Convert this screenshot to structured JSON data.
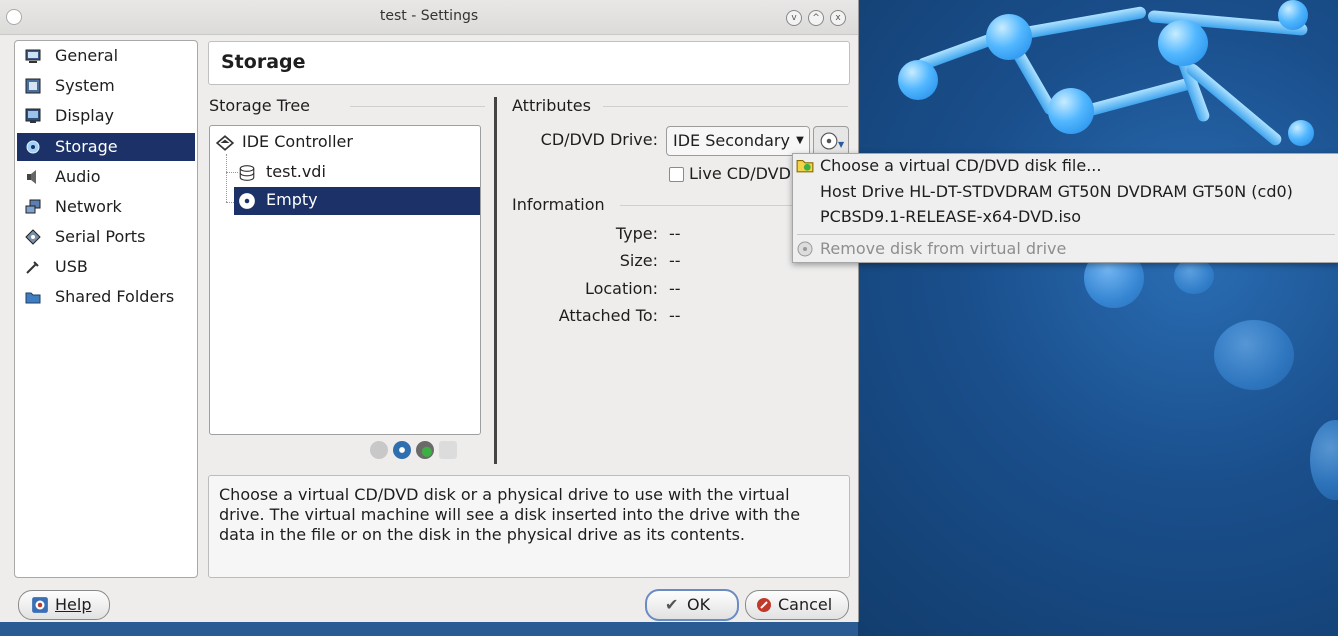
{
  "window": {
    "title": "test - Settings"
  },
  "categories": [
    {
      "label": "General",
      "icon": "monitor-icon"
    },
    {
      "label": "System",
      "icon": "chip-icon"
    },
    {
      "label": "Display",
      "icon": "display-icon"
    },
    {
      "label": "Storage",
      "icon": "disk-icon",
      "selected": true
    },
    {
      "label": "Audio",
      "icon": "speaker-icon"
    },
    {
      "label": "Network",
      "icon": "network-icon"
    },
    {
      "label": "Serial Ports",
      "icon": "serial-icon"
    },
    {
      "label": "USB",
      "icon": "usb-icon"
    },
    {
      "label": "Shared Folders",
      "icon": "folder-icon"
    }
  ],
  "header": {
    "title": "Storage"
  },
  "storage_tree": {
    "heading": "Storage Tree",
    "controller": "IDE Controller",
    "items": [
      {
        "label": "test.vdi",
        "icon": "hdd-icon"
      },
      {
        "label": "Empty",
        "icon": "cd-icon",
        "selected": true
      }
    ]
  },
  "attributes": {
    "heading": "Attributes",
    "cd_drive_label": "CD/DVD Drive:",
    "cd_drive_value": "IDE Secondary Master",
    "live_cd_label": "Live CD/DVD"
  },
  "information": {
    "heading": "Information",
    "rows": [
      {
        "label": "Type:",
        "value": "--"
      },
      {
        "label": "Size:",
        "value": "--"
      },
      {
        "label": "Location:",
        "value": "--"
      },
      {
        "label": "Attached To:",
        "value": "--"
      }
    ]
  },
  "description": "Choose a virtual CD/DVD disk or a physical drive to use with the virtual drive. The virtual machine will see a disk inserted into the drive with the data in the file or on the disk in the physical drive as its contents.",
  "buttons": {
    "help": "Help",
    "ok": "OK",
    "cancel": "Cancel"
  },
  "popup_menu": {
    "items": [
      {
        "label": "Choose a virtual CD/DVD disk file...",
        "enabled": true
      },
      {
        "label": "Host Drive HL-DT-STDVDRAM GT50N DVDRAM GT50N (cd0)",
        "enabled": true
      },
      {
        "label": "PCBSD9.1-RELEASE-x64-DVD.iso",
        "enabled": true
      },
      {
        "label": "Remove disk from virtual drive",
        "enabled": false
      }
    ]
  },
  "colors": {
    "selection": "#1b3167",
    "desktop": "#1c4f86"
  }
}
